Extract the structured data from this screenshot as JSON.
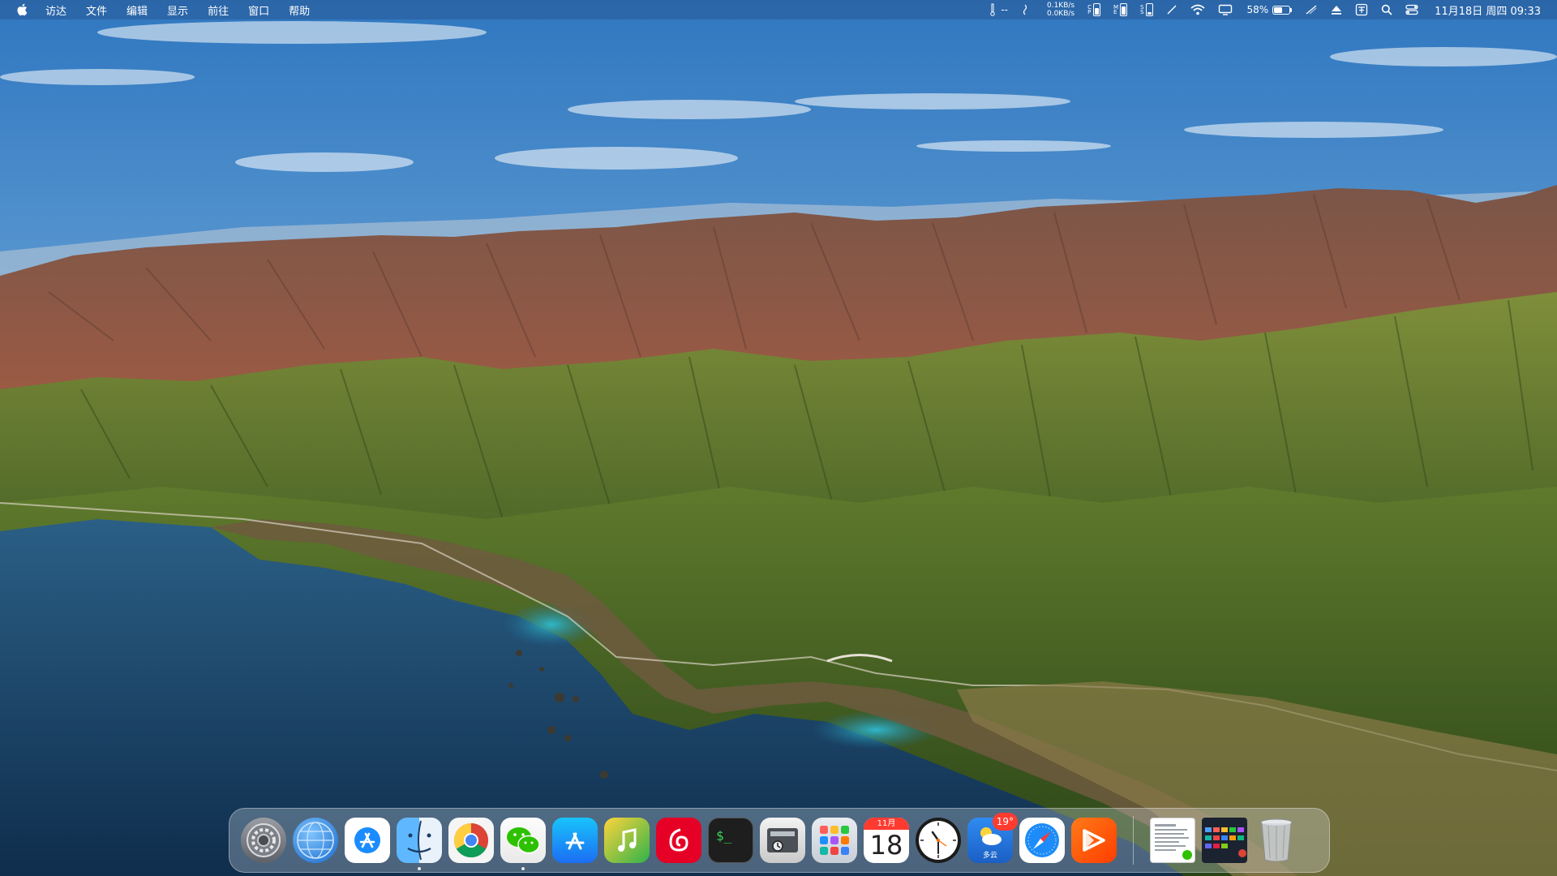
{
  "menubar": {
    "app_menus": [
      "访达",
      "文件",
      "编辑",
      "显示",
      "前往",
      "窗口",
      "帮助"
    ],
    "network_up": "0.1KB/s",
    "network_down": "0.0KB/s",
    "sensor_dash": "--",
    "battery_percent": "58%",
    "battery_level": 0.58,
    "datetime": "11月18日 周四 09:33"
  },
  "dock": {
    "apps": [
      {
        "name": "system-preferences",
        "running": false
      },
      {
        "name": "network-globe",
        "running": false
      },
      {
        "name": "app-store-blue",
        "running": false
      },
      {
        "name": "finder",
        "running": true
      },
      {
        "name": "chrome",
        "running": false
      },
      {
        "name": "wechat",
        "running": true
      },
      {
        "name": "app-store",
        "running": false
      },
      {
        "name": "music-note-app",
        "running": false
      },
      {
        "name": "netease-music",
        "running": false
      },
      {
        "name": "terminal",
        "running": false
      },
      {
        "name": "disk-utility",
        "running": false
      },
      {
        "name": "launchpad",
        "running": false
      },
      {
        "name": "calendar",
        "running": false
      },
      {
        "name": "clock",
        "running": false
      },
      {
        "name": "weather",
        "running": false
      },
      {
        "name": "safari",
        "running": false
      },
      {
        "name": "infuse",
        "running": false
      }
    ],
    "calendar_month": "11月",
    "calendar_day": "18",
    "weather_badge": "19°",
    "weather_label": "多云"
  },
  "colors": {
    "menubar_bg": "#3a78b8",
    "badge": "#ff3b30",
    "terminal_green": "#39d353"
  }
}
